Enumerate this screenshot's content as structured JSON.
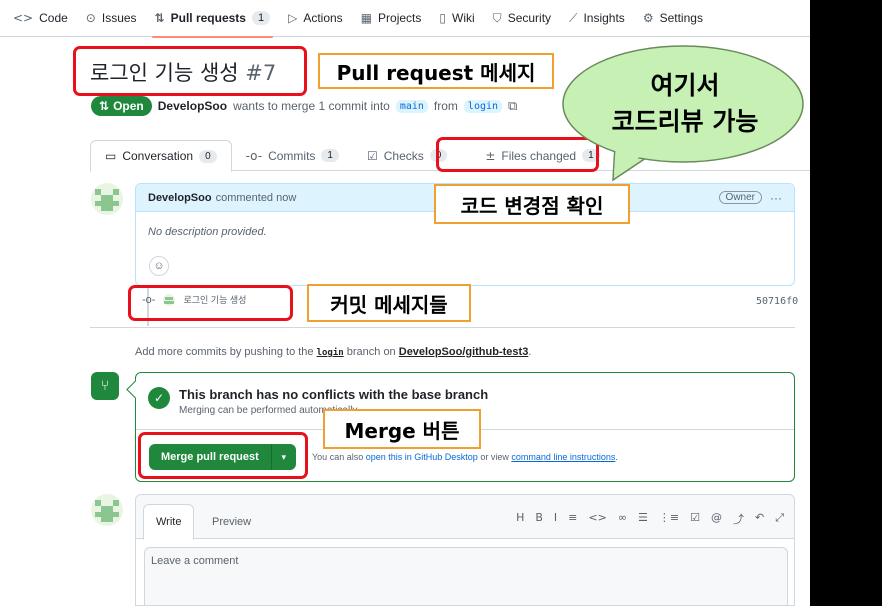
{
  "repo_nav": [
    {
      "icon": "<>",
      "label": "Code"
    },
    {
      "icon": "⊙",
      "label": "Issues"
    },
    {
      "icon": "⇅",
      "label": "Pull requests",
      "count": "1",
      "active": true
    },
    {
      "icon": "▷",
      "label": "Actions"
    },
    {
      "icon": "▦",
      "label": "Projects"
    },
    {
      "icon": "▯",
      "label": "Wiki"
    },
    {
      "icon": "⛉",
      "label": "Security"
    },
    {
      "icon": "⟋",
      "label": "Insights"
    },
    {
      "icon": "⚙",
      "label": "Settings"
    }
  ],
  "pr": {
    "title": "로그인 기능 생성",
    "number": "#7",
    "state": "Open",
    "author": "DevelopSoo",
    "merge_text": "wants to merge 1 commit into",
    "base_branch": "main",
    "from_text": "from",
    "head_branch": "login"
  },
  "tabs": [
    {
      "icon": "▭",
      "label": "Conversation",
      "count": "0"
    },
    {
      "icon": "-o-",
      "label": "Commits",
      "count": "1"
    },
    {
      "icon": "☑",
      "label": "Checks",
      "count": "0"
    },
    {
      "icon": "±",
      "label": "Files changed",
      "count": "1"
    }
  ],
  "comment": {
    "author": "DevelopSoo",
    "action": "commented now",
    "badge": "Owner",
    "menu": "···",
    "body": "No description provided.",
    "emoji": "☺"
  },
  "commit": {
    "message": "로그인 기능 생성",
    "sha": "50716f0"
  },
  "hint": {
    "prefix": "Add more commits by pushing to the",
    "branch": "login",
    "middle": "branch on",
    "repo": "DevelopSoo/github-test3",
    "suffix": "."
  },
  "merge": {
    "title": "This branch has no conflicts with the base branch",
    "subtitle": "Merging can be performed automatically.",
    "button": "Merge pull request",
    "caret": "▾",
    "alt_prefix": "You can also",
    "alt_link": "open this in GitHub Desktop",
    "alt_middle": "or view",
    "alt_link2": "command line instructions",
    "alt_suffix": "."
  },
  "editor": {
    "tab_write": "Write",
    "tab_preview": "Preview",
    "toolbar": [
      "H",
      "B",
      "I",
      "≡",
      "<>",
      "∞",
      "☰",
      "⋮≡",
      "☑",
      "@",
      "⤴",
      "↶",
      "⤢"
    ],
    "placeholder": "Leave a comment"
  },
  "annotations": {
    "pr_message": "Pull request 메세지",
    "code_changes": "코드 변경점 확인",
    "commit_messages": "커밋 메세지들",
    "merge_button": "Merge 버튼",
    "bubble_line1": "여기서",
    "bubble_line2": "코드리뷰 가능"
  },
  "colors": {
    "green": "#1f883d",
    "red_box": "#e8101a",
    "orange_label": "#f0a030",
    "bubble_fill": "#c6f0b4"
  }
}
